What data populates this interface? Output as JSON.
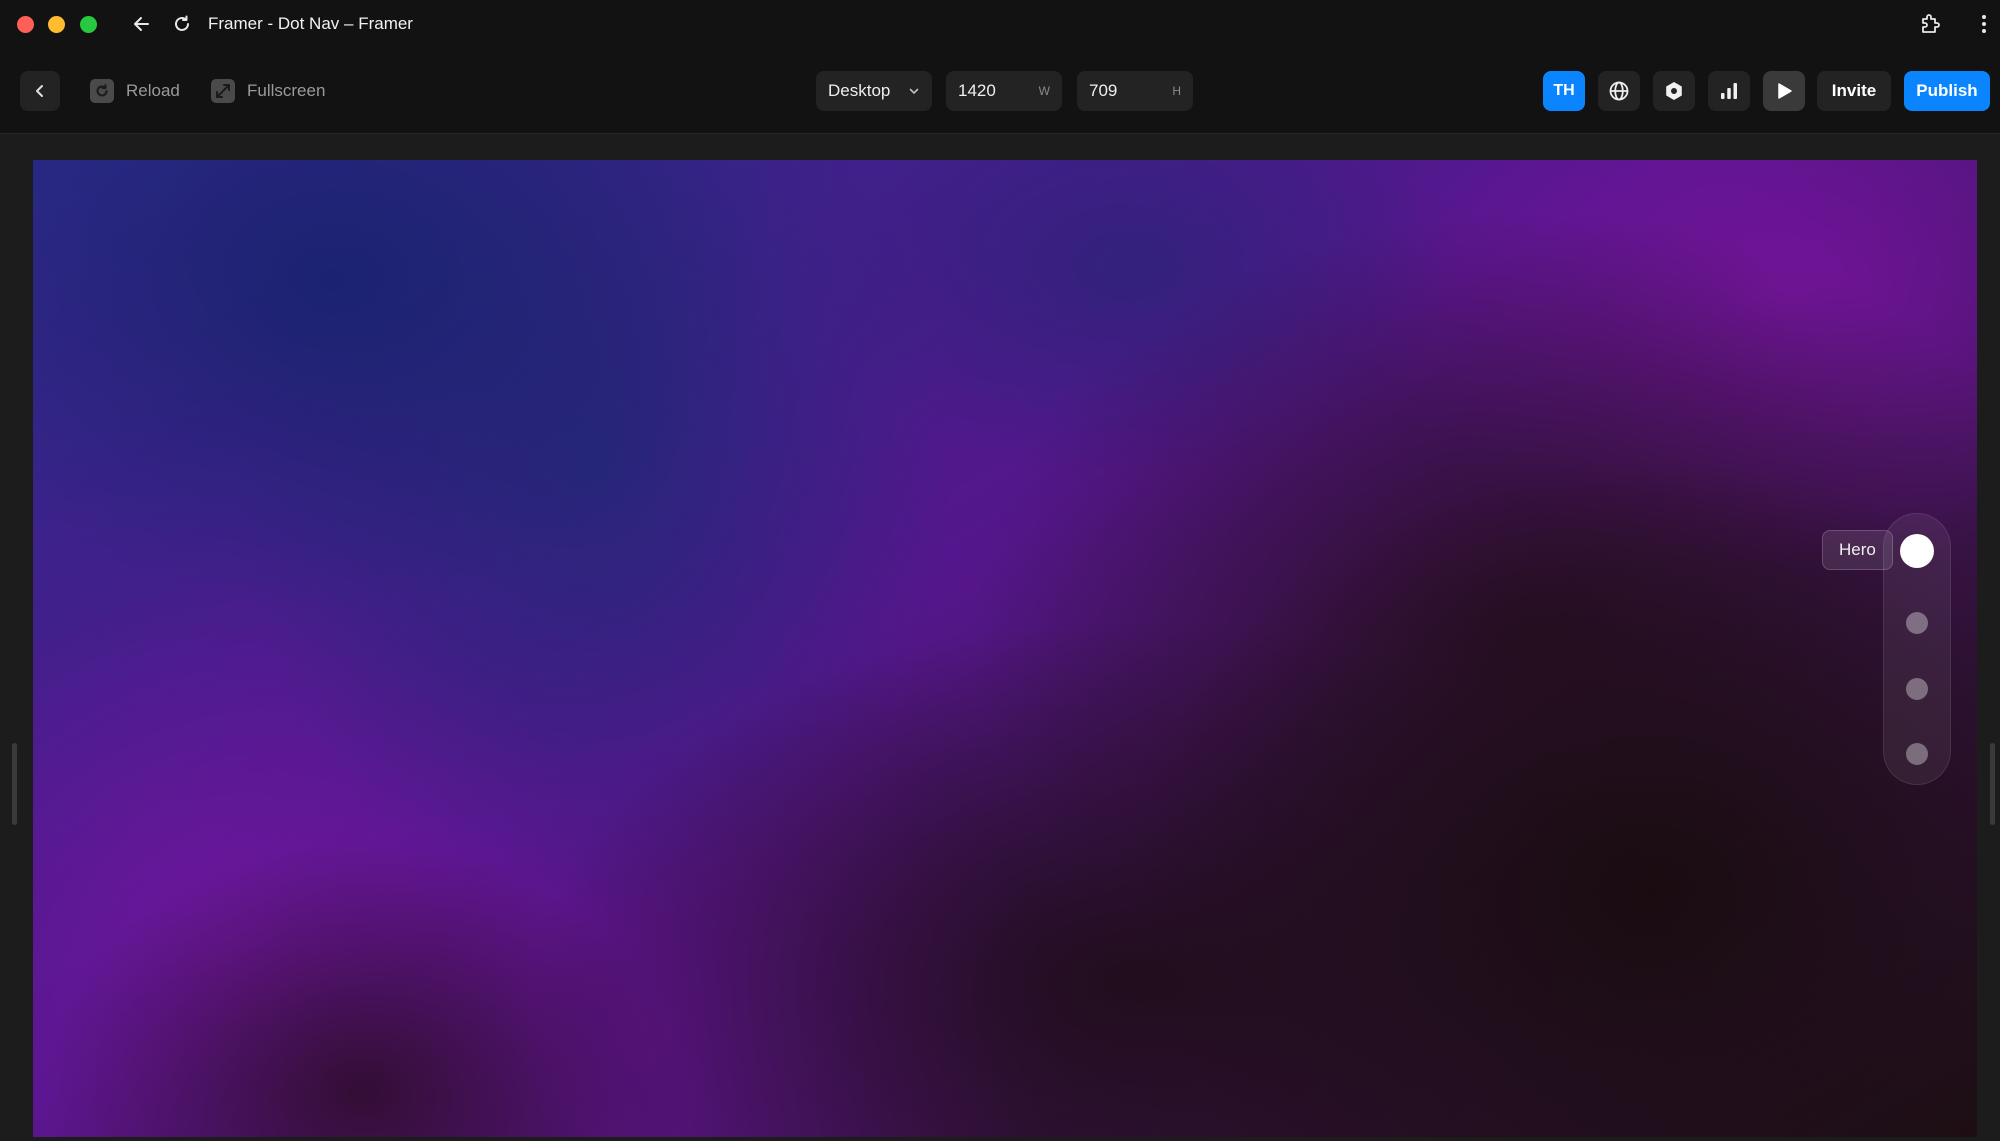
{
  "window": {
    "title": "Framer - Dot Nav – Framer"
  },
  "toolbar": {
    "reload_label": "Reload",
    "fullscreen_label": "Fullscreen",
    "device": "Desktop",
    "width_value": "1420",
    "width_suffix": "W",
    "height_value": "709",
    "height_suffix": "H",
    "avatar_initials": "TH",
    "invite_label": "Invite",
    "publish_label": "Publish"
  },
  "dot_nav": {
    "active_label": "Hero",
    "dot_count": 4,
    "active_index": 0
  },
  "icons": {
    "back": "arrow-left-icon",
    "reload": "refresh-icon",
    "extension": "puzzle-icon",
    "more": "more-vertical-icon",
    "chevron": "chevron-left-icon",
    "globe": "globe-icon",
    "settings": "hexagon-icon",
    "analytics": "bar-chart-icon",
    "preview": "play-icon"
  },
  "colors": {
    "accent": "#0a84ff",
    "window_bg": "#121212",
    "canvas_bg": "#1c1c1c"
  }
}
